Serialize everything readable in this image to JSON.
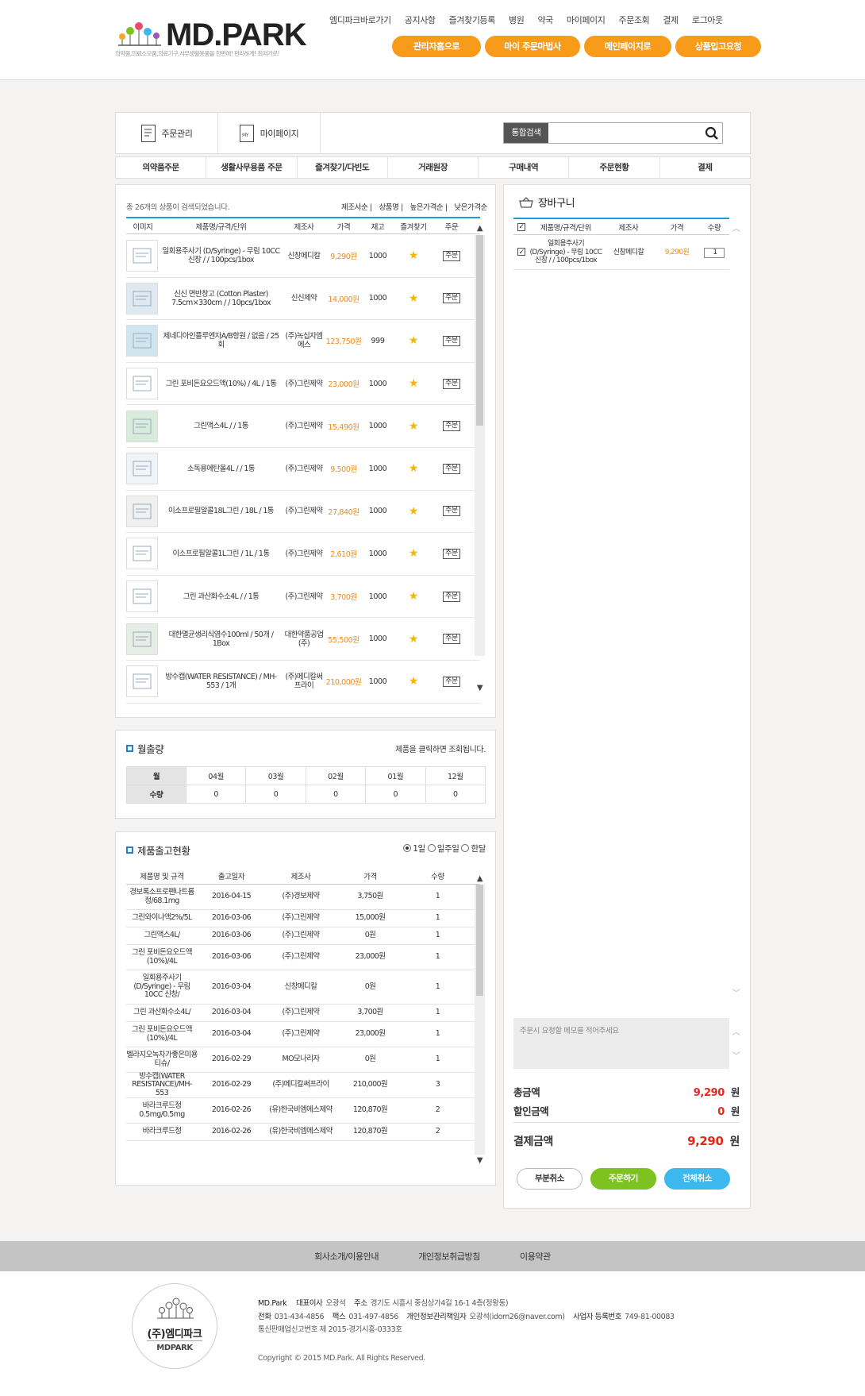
{
  "brand": {
    "name": "MD.PARK",
    "slogan": "의약품,의료소모품,의료기구,서무생활용품을 한번에! 편리하게! 최저가로!"
  },
  "topnav": [
    "엠디파크바로가기",
    "공지사항",
    "즐겨찾기등록",
    "병원",
    "약국",
    "마이페이지",
    "주문조회",
    "결제",
    "로그아웃"
  ],
  "orange_buttons": [
    "관리자홈으로",
    "마이 주문마법사",
    "메인페이지로",
    "상품입고요청"
  ],
  "colors": {
    "accent": "#f99b1a",
    "blue": "#1e9be0",
    "price": "#f08a1b",
    "total": "#e0291b",
    "green": "#7dc21e",
    "cyan": "#3cb8ee"
  },
  "subtabs": [
    {
      "label": "주문관리",
      "icon": "order-document-icon"
    },
    {
      "label": "마이페이지",
      "icon": "mypage-icon"
    }
  ],
  "search": {
    "label": "통합검색",
    "value": ""
  },
  "categories": [
    "의약품주문",
    "생활사무용품 주문",
    "즐겨찾기/다빈도",
    "거래원장",
    "구매내역",
    "주문현황",
    "결제"
  ],
  "list": {
    "count_text": "총 26개의 상품이 검색되었습니다.",
    "sorts": [
      "제조사순",
      "상품명",
      "높은가격순",
      "낮은가격순"
    ],
    "headers": [
      "이미지",
      "제품명/규격/단위",
      "제조사",
      "가격",
      "재고",
      "즐겨찾기",
      "주문"
    ],
    "order_label": "주문",
    "rows": [
      {
        "name": "일회용주사기 (D/Syringe) - 무림 10CC 신창 / / 100pcs/1box",
        "maker": "신창메디칼",
        "price": "9,290원",
        "stock": "1000"
      },
      {
        "name": "신신 면반창고 (Cotton Plaster) 7.5cm×330cm / / 10pcs/1box",
        "maker": "신신제약",
        "price": "14,000원",
        "stock": "1000"
      },
      {
        "name": "제네디아인플루엔자A/B항원 / 없음 / 25회",
        "maker": "(주)녹십자엠에스",
        "price": "123,750원",
        "stock": "999"
      },
      {
        "name": "그린 포비돈요오드액(10%) / 4L / 1통",
        "maker": "(주)그린제약",
        "price": "23,000원",
        "stock": "1000"
      },
      {
        "name": "그린액스4L / / 1통",
        "maker": "(주)그린제약",
        "price": "15,490원",
        "stock": "1000"
      },
      {
        "name": "소독용에탄올4L / / 1통",
        "maker": "(주)그린제약",
        "price": "9,500원",
        "stock": "1000"
      },
      {
        "name": "이소프로필알콜18L그린 / 18L / 1통",
        "maker": "(주)그린제약",
        "price": "27,840원",
        "stock": "1000"
      },
      {
        "name": "이소프로필알콜1L그린 / 1L / 1통",
        "maker": "(주)그린제약",
        "price": "2,610원",
        "stock": "1000"
      },
      {
        "name": "그린 과산화수소4L / / 1통",
        "maker": "(주)그린제약",
        "price": "3,700원",
        "stock": "1000"
      },
      {
        "name": "대한멸균생리식염수100ml / 50개 / 1Box",
        "maker": "대한약품공업(주)",
        "price": "55,500원",
        "stock": "1000"
      },
      {
        "name": "방수캡(WATER RESISTANCE) / MH-553 / 1개",
        "maker": "(주)메디칼써프라이",
        "price": "210,000원",
        "stock": "1000"
      }
    ]
  },
  "monthly": {
    "title": "월출량",
    "hint": "제품을 클릭하면 조회됩니다.",
    "row_month": "월",
    "row_qty": "수량",
    "months": [
      "04월",
      "03월",
      "02월",
      "01월",
      "12월"
    ],
    "qtys": [
      "0",
      "0",
      "0",
      "0",
      "0"
    ]
  },
  "shipments": {
    "title": "제품출고현황",
    "periods": [
      {
        "label": "1일",
        "checked": true
      },
      {
        "label": "일주일",
        "checked": false
      },
      {
        "label": "한달",
        "checked": false
      }
    ],
    "headers": [
      "제품명 및 규격",
      "출고일자",
      "제조사",
      "가격",
      "수량"
    ],
    "rows": [
      {
        "name": "경보록소프로펜나트륨정/68.1mg",
        "date": "2016-04-15",
        "maker": "(주)경보제약",
        "price": "3,750원",
        "qty": "1"
      },
      {
        "name": "그린와이나액2%/5L",
        "date": "2016-03-06",
        "maker": "(주)그린제약",
        "price": "15,000원",
        "qty": "1"
      },
      {
        "name": "그린액스4L/",
        "date": "2016-03-06",
        "maker": "(주)그린제약",
        "price": "0원",
        "qty": "1"
      },
      {
        "name": "그린 포비돈요오드액(10%)/4L",
        "date": "2016-03-06",
        "maker": "(주)그린제약",
        "price": "23,000원",
        "qty": "1"
      },
      {
        "name": "일회용주사기(D/Syringe) - 무림 10CC 신창/",
        "date": "2016-03-04",
        "maker": "신창메디칼",
        "price": "0원",
        "qty": "1"
      },
      {
        "name": "그린 과산화수소4L/",
        "date": "2016-03-04",
        "maker": "(주)그린제약",
        "price": "3,700원",
        "qty": "1"
      },
      {
        "name": "그린 포비돈요오드액(10%)/4L",
        "date": "2016-03-04",
        "maker": "(주)그린제약",
        "price": "23,000원",
        "qty": "1"
      },
      {
        "name": "벨라지오녹차가좋은미용티슈/",
        "date": "2016-02-29",
        "maker": "MO모나리자",
        "price": "0원",
        "qty": "1"
      },
      {
        "name": "방수캡(WATER RESISTANCE)/MH-553",
        "date": "2016-02-29",
        "maker": "(주)메디칼써프라이",
        "price": "210,000원",
        "qty": "3"
      },
      {
        "name": "바라크루드정0.5mg/0.5mg",
        "date": "2016-02-26",
        "maker": "(유)한국비엠에스제약",
        "price": "120,870원",
        "qty": "2"
      },
      {
        "name": "바라크루드정",
        "date": "2016-02-26",
        "maker": "(유)한국비엠에스제약",
        "price": "120,870원",
        "qty": "2"
      }
    ]
  },
  "cart": {
    "title": "장바구니",
    "headers": [
      "제품명/규격/단위",
      "제조사",
      "가격",
      "수량"
    ],
    "item": {
      "name": "일회용주사기 (D/Syringe) - 무림 10CC 신창 / / 100pcs/1box",
      "maker": "신창메디칼",
      "price": "9,290원",
      "qty": "1"
    },
    "memo_placeholder": "주문시 요청할 메모를 적어주세요",
    "total_label": "총금액",
    "total_value": "9,290",
    "discount_label": "할인금액",
    "discount_value": "0",
    "pay_label": "결제금액",
    "pay_value": "9,290",
    "unit": "원",
    "buttons": [
      "부분취소",
      "주문하기",
      "전체취소"
    ]
  },
  "footer": {
    "links": [
      "회사소개/이용안내",
      "개인정보취급방침",
      "이용약관"
    ],
    "seal_name": "(주)엠디파크",
    "seal_sub": "MDPARK",
    "line1": {
      "company": "MD.Park",
      "ceo_label": "대표이사",
      "ceo": "오광석",
      "addr_label": "주소",
      "addr": "경기도 시흥시 중심상가4길 16-1 4층(정왕동)"
    },
    "line2": {
      "tel_label": "전화",
      "tel": "031-434-4856",
      "fax_label": "팩스",
      "fax": "031-497-4856",
      "privacy_label": "개인정보관리책임자",
      "privacy": "오광석(idom26@naver.com)",
      "biz_label": "사업자 등록번호",
      "biz": "749-81-00083"
    },
    "line3": "통신판매업신고번호 제 2015-경기시흥-0333호",
    "copyright": "Copyright © 2015 MD.Park. All Rights Reserved."
  }
}
